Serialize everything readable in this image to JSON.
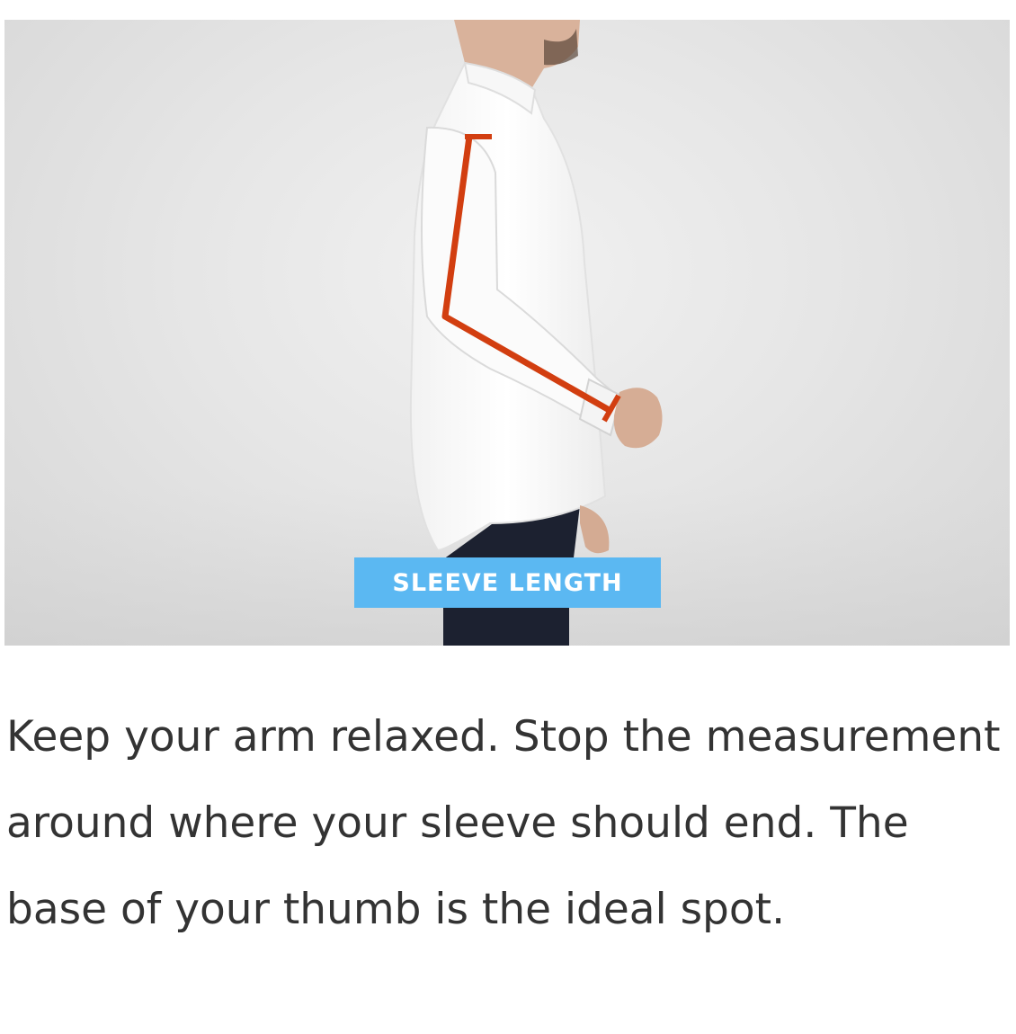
{
  "figure": {
    "badge_label": "SLEEVE LENGTH",
    "measure_color": "#d23e10",
    "badge_color": "#5bb8f2"
  },
  "caption": {
    "text": "Keep your arm relaxed. Stop the measurement around where your sleeve should end. The base of your thumb is the ideal spot."
  }
}
